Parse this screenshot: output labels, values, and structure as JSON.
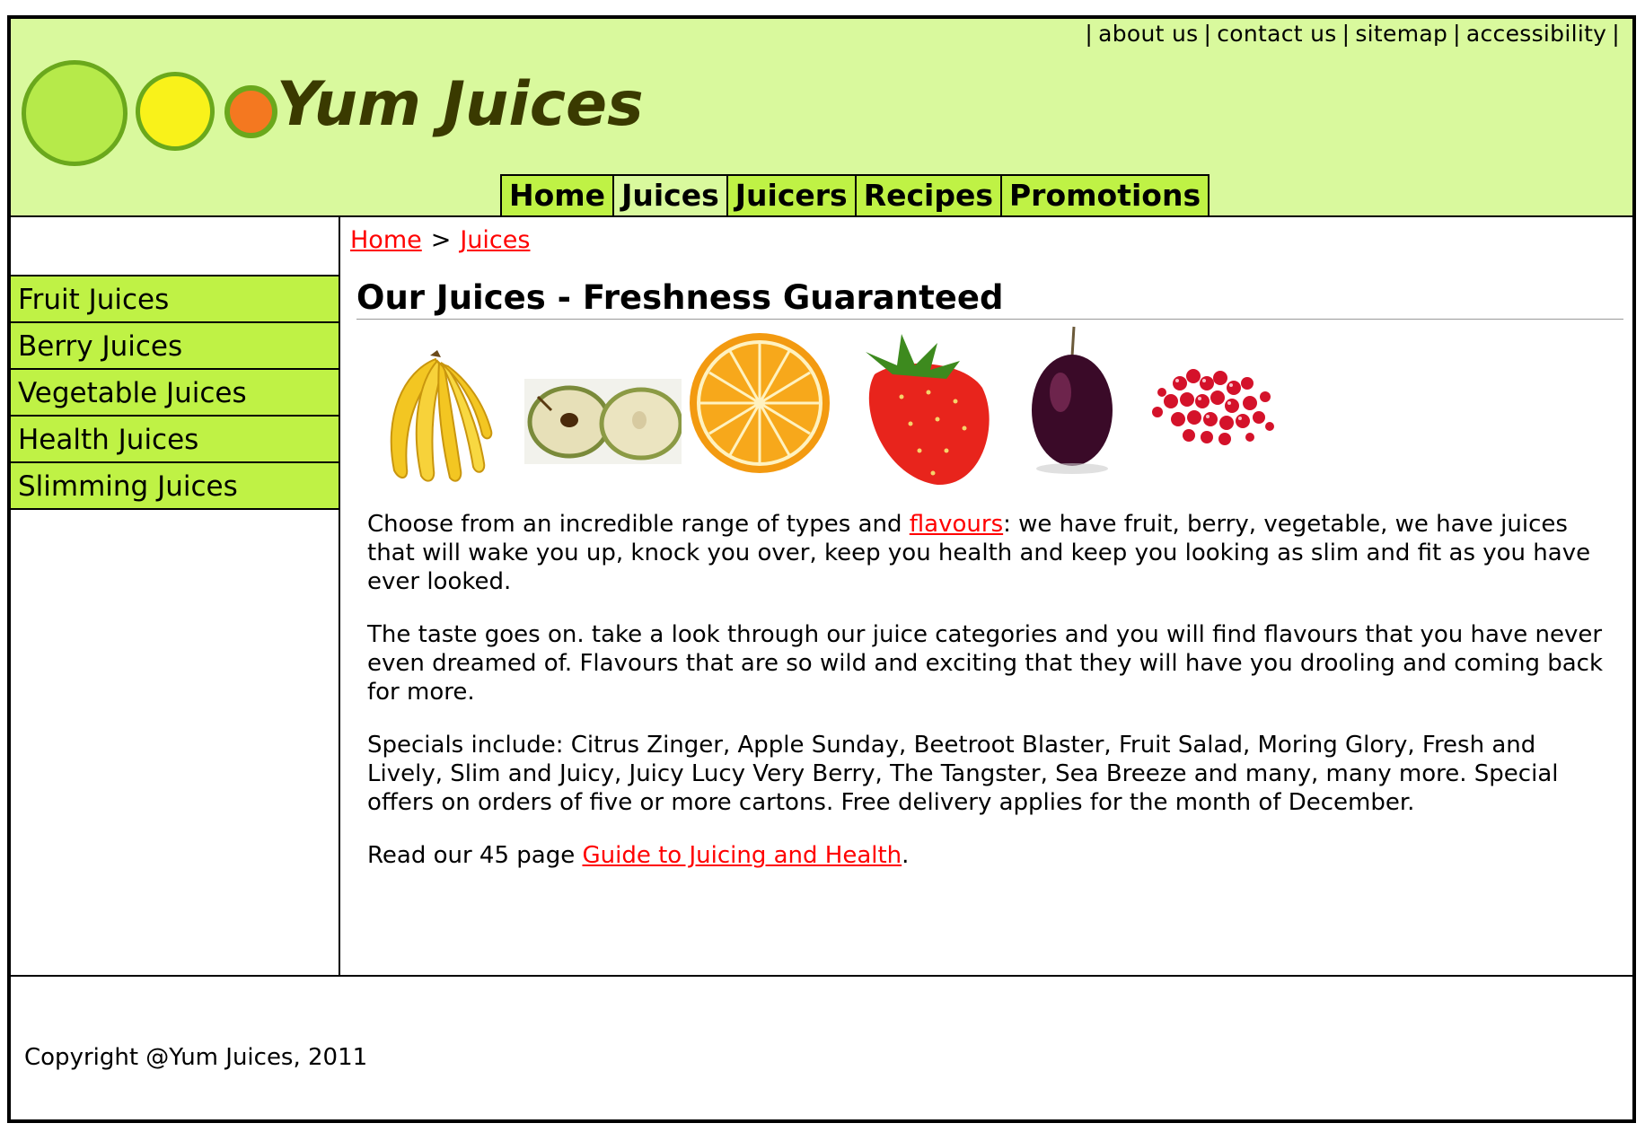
{
  "header": {
    "top_links": [
      "about us",
      "contact us",
      "sitemap",
      "accessibility"
    ],
    "top_separator": "|",
    "logo_text": "Yum Juices",
    "logo_colors": [
      "#b6ea4a",
      "#f9f21a",
      "#f47820"
    ],
    "nav": [
      {
        "label": "Home",
        "active": false
      },
      {
        "label": "Juices",
        "active": true
      },
      {
        "label": "Juicers",
        "active": false
      },
      {
        "label": "Recipes",
        "active": false
      },
      {
        "label": "Promotions",
        "active": false
      }
    ]
  },
  "sidebar": {
    "items": [
      "Fruit Juices",
      "Berry Juices",
      "Vegetable Juices",
      "Health Juices",
      "Slimming Juices"
    ]
  },
  "main": {
    "breadcrumb": {
      "home": "Home",
      "separator": ">",
      "current": "Juices"
    },
    "heading": "Our Juices - Freshness Guaranteed",
    "fruit_images": [
      "banana-image",
      "apple-image",
      "orange-image",
      "strawberry-image",
      "plum-image",
      "pomegranate-image"
    ],
    "para1_before": "Choose from an incredible range of types and ",
    "para1_link": "flavours",
    "para1_after": ": we have fruit, berry, vegetable, we have juices that will wake you up, knock you over, keep you health and keep you looking as slim and fit as you have ever looked.",
    "para2": "The taste goes on. take a look through our juice categories and you will find flavours that you have never even dreamed of. Flavours that are so wild and exciting that they will have you drooling and coming back for more.",
    "para3": "Specials include: Citrus Zinger, Apple Sunday, Beetroot Blaster, Fruit Salad, Moring Glory, Fresh and Lively, Slim and Juicy, Juicy Lucy Very Berry, The Tangster, Sea Breeze and many, many more. Special offers on orders of five or more cartons. Free delivery applies for the month of December.",
    "para4_before": "Read our 45 page ",
    "para4_link": "Guide to Juicing and Health",
    "para4_after": "."
  },
  "footer": {
    "copyright": "Copyright @Yum Juices, 2011"
  },
  "colors": {
    "header_bg": "#d9f99d",
    "nav_bg": "#bff245",
    "link": "#ff0000"
  }
}
